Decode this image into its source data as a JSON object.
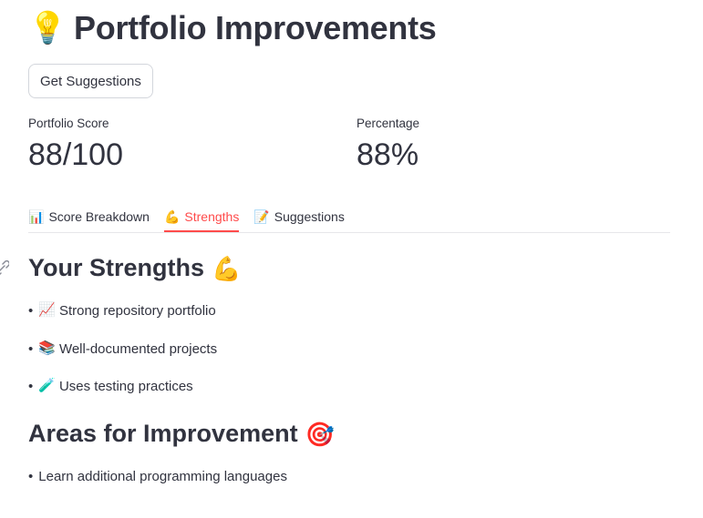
{
  "page": {
    "title": "Portfolio Improvements",
    "title_icon": "💡"
  },
  "actions": {
    "get_suggestions_label": "Get Suggestions"
  },
  "metrics": [
    {
      "label": "Portfolio Score",
      "value": "88/100"
    },
    {
      "label": "Percentage",
      "value": "88%"
    }
  ],
  "tabs": [
    {
      "icon": "📊",
      "label": "Score Breakdown",
      "active": false
    },
    {
      "icon": "💪",
      "label": "Strengths",
      "active": true
    },
    {
      "icon": "📝",
      "label": "Suggestions",
      "active": false
    }
  ],
  "strengths": {
    "heading": "Your Strengths",
    "heading_icon": "💪",
    "items": [
      {
        "icon": "📈",
        "text": "Strong repository portfolio"
      },
      {
        "icon": "📚",
        "text": "Well-documented projects"
      },
      {
        "icon": "🧪",
        "text": "Uses testing practices"
      }
    ]
  },
  "improvements": {
    "heading": "Areas for Improvement",
    "heading_icon": "🎯",
    "items": [
      {
        "text": "Learn additional programming languages"
      }
    ]
  },
  "colors": {
    "accent": "#ff4b4b",
    "text": "#31333f",
    "border": "#d3d6dc"
  }
}
